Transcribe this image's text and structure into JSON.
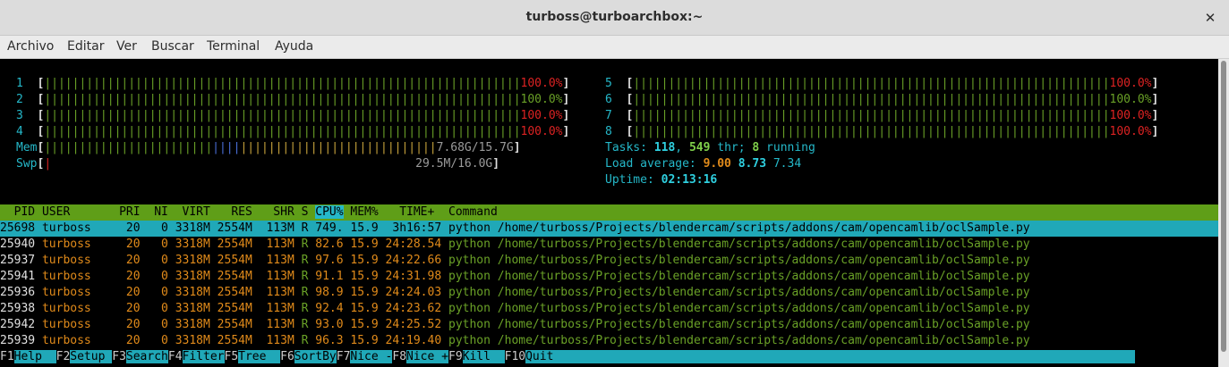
{
  "window": {
    "title": "turboss@turboarchbox:~",
    "close_glyph": "✕"
  },
  "menu": [
    "Archivo",
    "Editar",
    "Ver",
    "Buscar",
    "Terminal",
    "Ayuda"
  ],
  "cpu_bars": [
    {
      "label": "1",
      "bars": "||||||||||||||||||||||||||||||||||||||||||||||||||||||||||||||||||||",
      "value": "100.0%"
    },
    {
      "label": "2",
      "bars": "||||||||||||||||||||||||||||||||||||||||||||||||||||||||||||||||||||",
      "value": "100.0%"
    },
    {
      "label": "3",
      "bars": "||||||||||||||||||||||||||||||||||||||||||||||||||||||||||||||||||||",
      "value": "100.0%"
    },
    {
      "label": "4",
      "bars": "||||||||||||||||||||||||||||||||||||||||||||||||||||||||||||||||||||",
      "value": "100.0%"
    },
    {
      "label": "5",
      "bars": "||||||||||||||||||||||||||||||||||||||||||||||||||||||||||||||||||||",
      "value": "100.0%"
    },
    {
      "label": "6",
      "bars": "||||||||||||||||||||||||||||||||||||||||||||||||||||||||||||||||||||",
      "value": "100.0%"
    },
    {
      "label": "7",
      "bars": "||||||||||||||||||||||||||||||||||||||||||||||||||||||||||||||||||||",
      "value": "100.0%"
    },
    {
      "label": "8",
      "bars": "||||||||||||||||||||||||||||||||||||||||||||||||||||||||||||||||||||",
      "value": "100.0%"
    }
  ],
  "mem": {
    "label": "Mem",
    "value": "7.68G/15.7G"
  },
  "swp": {
    "label": "Swp",
    "value": "29.5M/16.0G"
  },
  "tasks": {
    "label": "Tasks: ",
    "count": "118",
    "sep": ", ",
    "threads": "549",
    "thr_label": " thr; ",
    "running": "8",
    "running_label": " running"
  },
  "load": {
    "label": "Load average: ",
    "l1": "9.00",
    "l5": "8.73",
    "l15": "7.34"
  },
  "uptime": {
    "label": "Uptime: ",
    "value": "02:13:16"
  },
  "columns": [
    "PID",
    "USER",
    "PRI",
    "NI",
    "VIRT",
    "RES",
    "SHR",
    "S",
    "CPU%",
    "MEM%",
    "TIME+",
    "Command"
  ],
  "processes": [
    {
      "pid": "25698",
      "user": "turboss",
      "pri": "20",
      "ni": "0",
      "virt": "3318M",
      "res": "2554M",
      "shr": "113M",
      "s": "R",
      "cpu": "749.",
      "mem": "15.9",
      "time": "3h16:57",
      "cmd": "python",
      "args": "/home/turboss/Projects/blendercam/scripts/addons/cam/opencamlib/oclSample.py"
    },
    {
      "pid": "25940",
      "user": "turboss",
      "pri": "20",
      "ni": "0",
      "virt": "3318M",
      "res": "2554M",
      "shr": "113M",
      "s": "R",
      "cpu": "82.6",
      "mem": "15.9",
      "time": "24:28.54",
      "cmd": "python",
      "args": "/home/turboss/Projects/blendercam/scripts/addons/cam/opencamlib/oclSample.py"
    },
    {
      "pid": "25937",
      "user": "turboss",
      "pri": "20",
      "ni": "0",
      "virt": "3318M",
      "res": "2554M",
      "shr": "113M",
      "s": "R",
      "cpu": "97.6",
      "mem": "15.9",
      "time": "24:22.66",
      "cmd": "python",
      "args": "/home/turboss/Projects/blendercam/scripts/addons/cam/opencamlib/oclSample.py"
    },
    {
      "pid": "25941",
      "user": "turboss",
      "pri": "20",
      "ni": "0",
      "virt": "3318M",
      "res": "2554M",
      "shr": "113M",
      "s": "R",
      "cpu": "91.1",
      "mem": "15.9",
      "time": "24:31.98",
      "cmd": "python",
      "args": "/home/turboss/Projects/blendercam/scripts/addons/cam/opencamlib/oclSample.py"
    },
    {
      "pid": "25936",
      "user": "turboss",
      "pri": "20",
      "ni": "0",
      "virt": "3318M",
      "res": "2554M",
      "shr": "113M",
      "s": "R",
      "cpu": "98.9",
      "mem": "15.9",
      "time": "24:24.03",
      "cmd": "python",
      "args": "/home/turboss/Projects/blendercam/scripts/addons/cam/opencamlib/oclSample.py"
    },
    {
      "pid": "25938",
      "user": "turboss",
      "pri": "20",
      "ni": "0",
      "virt": "3318M",
      "res": "2554M",
      "shr": "113M",
      "s": "R",
      "cpu": "92.4",
      "mem": "15.9",
      "time": "24:23.62",
      "cmd": "python",
      "args": "/home/turboss/Projects/blendercam/scripts/addons/cam/opencamlib/oclSample.py"
    },
    {
      "pid": "25942",
      "user": "turboss",
      "pri": "20",
      "ni": "0",
      "virt": "3318M",
      "res": "2554M",
      "shr": "113M",
      "s": "R",
      "cpu": "93.0",
      "mem": "15.9",
      "time": "24:25.52",
      "cmd": "python",
      "args": "/home/turboss/Projects/blendercam/scripts/addons/cam/opencamlib/oclSample.py"
    },
    {
      "pid": "25939",
      "user": "turboss",
      "pri": "20",
      "ni": "0",
      "virt": "3318M",
      "res": "2554M",
      "shr": "113M",
      "s": "R",
      "cpu": "96.3",
      "mem": "15.9",
      "time": "24:19.40",
      "cmd": "python",
      "args": "/home/turboss/Projects/blendercam/scripts/addons/cam/opencamlib/oclSample.py"
    }
  ],
  "fkeys": [
    {
      "key": "F1",
      "label": "Help  "
    },
    {
      "key": "F2",
      "label": "Setup "
    },
    {
      "key": "F3",
      "label": "Search"
    },
    {
      "key": "F4",
      "label": "Filter"
    },
    {
      "key": "F5",
      "label": "Tree  "
    },
    {
      "key": "F6",
      "label": "SortBy"
    },
    {
      "key": "F7",
      "label": "Nice -"
    },
    {
      "key": "F8",
      "label": "Nice +"
    },
    {
      "key": "F9",
      "label": "Kill  "
    },
    {
      "key": "F10",
      "label": "Quit"
    }
  ],
  "colors": {
    "header_bg": "#5f9e18",
    "selected_bg": "#20a8b8",
    "cpu_bar": "#6aa127",
    "value_red": "#d22"
  }
}
